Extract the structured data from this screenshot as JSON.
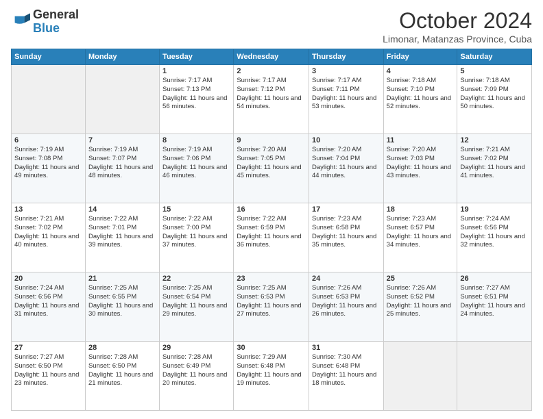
{
  "logo": {
    "line1": "General",
    "line2": "Blue"
  },
  "title": "October 2024",
  "subtitle": "Limonar, Matanzas Province, Cuba",
  "days_of_week": [
    "Sunday",
    "Monday",
    "Tuesday",
    "Wednesday",
    "Thursday",
    "Friday",
    "Saturday"
  ],
  "weeks": [
    [
      {
        "day": "",
        "info": ""
      },
      {
        "day": "",
        "info": ""
      },
      {
        "day": "1",
        "info": "Sunrise: 7:17 AM\nSunset: 7:13 PM\nDaylight: 11 hours and 56 minutes."
      },
      {
        "day": "2",
        "info": "Sunrise: 7:17 AM\nSunset: 7:12 PM\nDaylight: 11 hours and 54 minutes."
      },
      {
        "day": "3",
        "info": "Sunrise: 7:17 AM\nSunset: 7:11 PM\nDaylight: 11 hours and 53 minutes."
      },
      {
        "day": "4",
        "info": "Sunrise: 7:18 AM\nSunset: 7:10 PM\nDaylight: 11 hours and 52 minutes."
      },
      {
        "day": "5",
        "info": "Sunrise: 7:18 AM\nSunset: 7:09 PM\nDaylight: 11 hours and 50 minutes."
      }
    ],
    [
      {
        "day": "6",
        "info": "Sunrise: 7:19 AM\nSunset: 7:08 PM\nDaylight: 11 hours and 49 minutes."
      },
      {
        "day": "7",
        "info": "Sunrise: 7:19 AM\nSunset: 7:07 PM\nDaylight: 11 hours and 48 minutes."
      },
      {
        "day": "8",
        "info": "Sunrise: 7:19 AM\nSunset: 7:06 PM\nDaylight: 11 hours and 46 minutes."
      },
      {
        "day": "9",
        "info": "Sunrise: 7:20 AM\nSunset: 7:05 PM\nDaylight: 11 hours and 45 minutes."
      },
      {
        "day": "10",
        "info": "Sunrise: 7:20 AM\nSunset: 7:04 PM\nDaylight: 11 hours and 44 minutes."
      },
      {
        "day": "11",
        "info": "Sunrise: 7:20 AM\nSunset: 7:03 PM\nDaylight: 11 hours and 43 minutes."
      },
      {
        "day": "12",
        "info": "Sunrise: 7:21 AM\nSunset: 7:02 PM\nDaylight: 11 hours and 41 minutes."
      }
    ],
    [
      {
        "day": "13",
        "info": "Sunrise: 7:21 AM\nSunset: 7:02 PM\nDaylight: 11 hours and 40 minutes."
      },
      {
        "day": "14",
        "info": "Sunrise: 7:22 AM\nSunset: 7:01 PM\nDaylight: 11 hours and 39 minutes."
      },
      {
        "day": "15",
        "info": "Sunrise: 7:22 AM\nSunset: 7:00 PM\nDaylight: 11 hours and 37 minutes."
      },
      {
        "day": "16",
        "info": "Sunrise: 7:22 AM\nSunset: 6:59 PM\nDaylight: 11 hours and 36 minutes."
      },
      {
        "day": "17",
        "info": "Sunrise: 7:23 AM\nSunset: 6:58 PM\nDaylight: 11 hours and 35 minutes."
      },
      {
        "day": "18",
        "info": "Sunrise: 7:23 AM\nSunset: 6:57 PM\nDaylight: 11 hours and 34 minutes."
      },
      {
        "day": "19",
        "info": "Sunrise: 7:24 AM\nSunset: 6:56 PM\nDaylight: 11 hours and 32 minutes."
      }
    ],
    [
      {
        "day": "20",
        "info": "Sunrise: 7:24 AM\nSunset: 6:56 PM\nDaylight: 11 hours and 31 minutes."
      },
      {
        "day": "21",
        "info": "Sunrise: 7:25 AM\nSunset: 6:55 PM\nDaylight: 11 hours and 30 minutes."
      },
      {
        "day": "22",
        "info": "Sunrise: 7:25 AM\nSunset: 6:54 PM\nDaylight: 11 hours and 29 minutes."
      },
      {
        "day": "23",
        "info": "Sunrise: 7:25 AM\nSunset: 6:53 PM\nDaylight: 11 hours and 27 minutes."
      },
      {
        "day": "24",
        "info": "Sunrise: 7:26 AM\nSunset: 6:53 PM\nDaylight: 11 hours and 26 minutes."
      },
      {
        "day": "25",
        "info": "Sunrise: 7:26 AM\nSunset: 6:52 PM\nDaylight: 11 hours and 25 minutes."
      },
      {
        "day": "26",
        "info": "Sunrise: 7:27 AM\nSunset: 6:51 PM\nDaylight: 11 hours and 24 minutes."
      }
    ],
    [
      {
        "day": "27",
        "info": "Sunrise: 7:27 AM\nSunset: 6:50 PM\nDaylight: 11 hours and 23 minutes."
      },
      {
        "day": "28",
        "info": "Sunrise: 7:28 AM\nSunset: 6:50 PM\nDaylight: 11 hours and 21 minutes."
      },
      {
        "day": "29",
        "info": "Sunrise: 7:28 AM\nSunset: 6:49 PM\nDaylight: 11 hours and 20 minutes."
      },
      {
        "day": "30",
        "info": "Sunrise: 7:29 AM\nSunset: 6:48 PM\nDaylight: 11 hours and 19 minutes."
      },
      {
        "day": "31",
        "info": "Sunrise: 7:30 AM\nSunset: 6:48 PM\nDaylight: 11 hours and 18 minutes."
      },
      {
        "day": "",
        "info": ""
      },
      {
        "day": "",
        "info": ""
      }
    ]
  ]
}
